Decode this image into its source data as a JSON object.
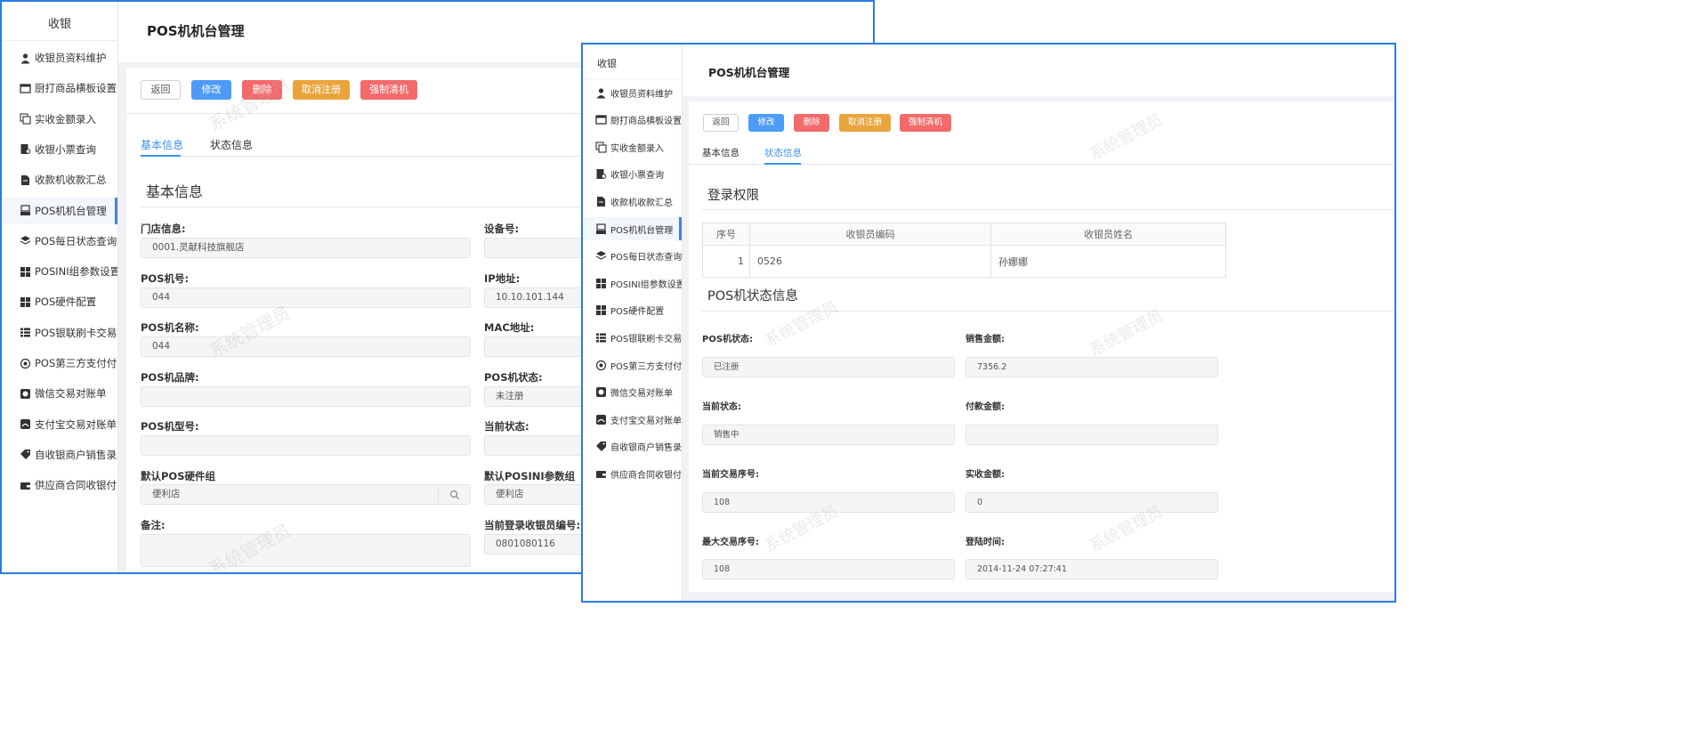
{
  "colors": {
    "window_border": "#2b7be4",
    "primary_blue": "#4e9bf5",
    "danger_red": "#f36a6a",
    "warning_orange": "#eaa43c",
    "tab_active": "#3d8fe8"
  },
  "window1": {
    "sidebar_title": "收银",
    "page_title": "POS机机台管理",
    "buttons": {
      "back": "返回",
      "edit": "修改",
      "delete": "删除",
      "cancel_register": "取消注册",
      "force_clear": "强制清机"
    },
    "tabs": [
      {
        "label": "基本信息",
        "active": true
      },
      {
        "label": "状态信息",
        "active": false
      }
    ],
    "section_title": "基本信息",
    "fields": {
      "store_label": "门店信息:",
      "store_value": "0001.灵献科技旗舰店",
      "device_label": "设备号:",
      "device_value": "",
      "pos_no_label": "POS机号:",
      "pos_no_value": "044",
      "ip_label": "IP地址:",
      "ip_value": "10.10.101.144",
      "pos_name_label": "POS机名称:",
      "pos_name_value": "044",
      "mac_label": "MAC地址:",
      "mac_value": "",
      "brand_label": "POS机品牌:",
      "brand_value": "",
      "status_label": "POS机状态:",
      "status_value": "未注册",
      "model_label": "POS机型号:",
      "model_value": "",
      "current_status_label": "当前状态:",
      "current_status_value": "",
      "hw_group_label": "默认POS硬件组",
      "hw_group_value": "便利店",
      "ini_group_label": "默认POSINI参数组",
      "ini_group_value": "便利店",
      "remark_label": "备注:",
      "remark_value": "",
      "cashier_no_label": "当前登录收银员编号:",
      "cashier_no_value": "0801080116"
    }
  },
  "window2": {
    "sidebar_title": "收银",
    "page_title": "POS机机台管理",
    "buttons": {
      "back": "返回",
      "edit": "修改",
      "delete": "删除",
      "cancel_register": "取消注册",
      "force_clear": "强制清机"
    },
    "tabs": [
      {
        "label": "基本信息",
        "active": false
      },
      {
        "label": "状态信息",
        "active": true
      }
    ],
    "login_section_title": "登录权限",
    "table": {
      "headers": [
        "序号",
        "收银员编码",
        "收银员姓名"
      ],
      "rows": [
        [
          "1",
          "0526",
          "孙娜娜"
        ]
      ]
    },
    "status_section_title": "POS机状态信息",
    "fields": {
      "pos_status_label": "POS机状态:",
      "pos_status_value": "已注册",
      "sales_label": "销售金额:",
      "sales_value": "7356.2",
      "current_status_label": "当前状态:",
      "current_status_value": "销售中",
      "paid_label": "付款金额:",
      "paid_value": "",
      "txn_no_label": "当前交易序号:",
      "txn_no_value": "108",
      "received_label": "实收金额:",
      "received_value": "0",
      "max_txn_label": "最大交易序号:",
      "max_txn_value": "108",
      "login_time_label": "登陆时间:",
      "login_time_value": "2014-11-24 07:27:41"
    }
  },
  "sidebar_items": [
    {
      "label": "收银员资料维护",
      "icon": "user-icon"
    },
    {
      "label": "厨打商品横板设置",
      "icon": "edit-window-icon"
    },
    {
      "label": "实收金额录入",
      "icon": "copy-icon"
    },
    {
      "label": "收银小票查询",
      "icon": "receipt-search-icon"
    },
    {
      "label": "收款机收款汇总",
      "icon": "document-edit-icon"
    },
    {
      "label": "POS机机台管理",
      "icon": "pos-terminal-icon"
    },
    {
      "label": "POS每日状态查询",
      "icon": "layers-icon"
    },
    {
      "label": "POSINI组参数设置",
      "icon": "grid-icon"
    },
    {
      "label": "POS硬件配置",
      "icon": "grid-icon"
    },
    {
      "label": "POS银联刷卡交易...",
      "icon": "list-icon"
    },
    {
      "label": "POS第三方支付付...",
      "icon": "gear-icon"
    },
    {
      "label": "微信交易对账单",
      "icon": "wechat-icon"
    },
    {
      "label": "支付宝交易对账单",
      "icon": "alipay-icon"
    },
    {
      "label": "自收银商户销售录入",
      "icon": "tag-icon"
    },
    {
      "label": "供应商合同收银付...",
      "icon": "wallet-icon"
    }
  ],
  "watermark": "系统管理员"
}
